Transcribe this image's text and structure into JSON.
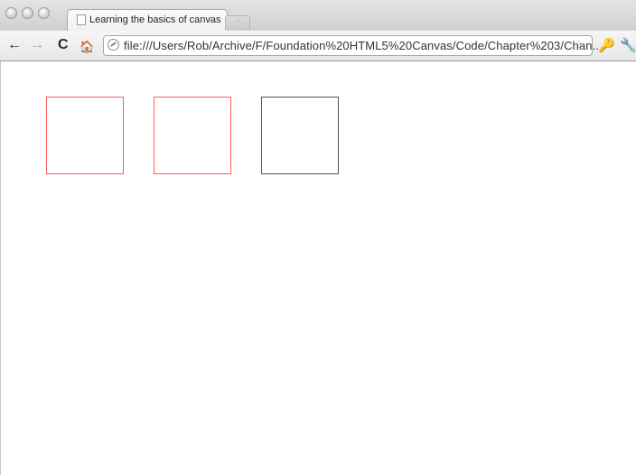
{
  "window": {
    "title": "Learning the basics of canvas"
  },
  "tab": {
    "title": "Learning the basics of canvas",
    "close_glyph": "×",
    "newtab_glyph": "+"
  },
  "toolbar": {
    "back_glyph": "←",
    "forward_glyph": "→",
    "reload_glyph": "C",
    "home_glyph": "🏠",
    "url": "file:///Users/Rob/Archive/F/Foundation%20HTML5%20Canvas/Code/Chapter%203/Chan...",
    "star_glyph": "☆",
    "page_menu_glyph": "🔑",
    "wrench_glyph": "🔧"
  },
  "canvas": {
    "squares": [
      {
        "stroke": "#ff5a5a"
      },
      {
        "stroke": "#ff5a5a"
      },
      {
        "stroke": "#555555"
      }
    ]
  },
  "colors": {
    "tab_bg": "#f4f4f4",
    "toolbar_bg": "#ececec",
    "page_bg": "#ffffff"
  }
}
